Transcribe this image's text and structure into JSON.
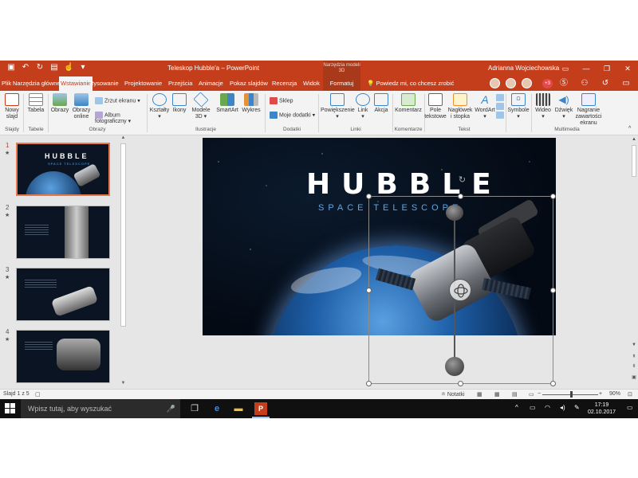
{
  "window": {
    "title": "Teleskop Hubble'a – PowerPoint",
    "context_header": "Narzędzia modeli 3D",
    "user_name": "Adrianna Wojciechowska",
    "collab_badge": "+3"
  },
  "tabs": [
    {
      "label": "Plik"
    },
    {
      "label": "Narzędzia główne"
    },
    {
      "label": "Wstawianie"
    },
    {
      "label": "Rysowanie"
    },
    {
      "label": "Projektowanie"
    },
    {
      "label": "Przejścia"
    },
    {
      "label": "Animacje"
    },
    {
      "label": "Pokaz slajdów"
    },
    {
      "label": "Recenzja"
    },
    {
      "label": "Widok"
    },
    {
      "label": "Formatuj"
    }
  ],
  "active_tab": "Wstawianie",
  "tell_me": "Powiedz mi, co chcesz zrobić",
  "ribbon": {
    "new_slide": "Nowy slajd",
    "table": "Tabela",
    "images": "Obrazy",
    "online_images": "Obrazy online",
    "screenshot": "Zrzut ekranu",
    "photo_album": "Album fotograficzny",
    "shapes": "Kształty",
    "icons": "Ikony",
    "models_3d": "Modele 3D",
    "smartart": "SmartArt",
    "chart": "Wykres",
    "store": "Sklep",
    "my_addins": "Moje dodatki",
    "zoom": "Powiększenie",
    "link": "Link",
    "action": "Akcja",
    "comment": "Komentarz",
    "textbox": "Pole tekstowe",
    "header_footer": "Nagłówek i stopka",
    "wordart": "WordArt",
    "symbols": "Symbole",
    "video": "Wideo",
    "audio": "Dźwięk",
    "screen_recording": "Nagranie zawartości ekranu",
    "groups": {
      "slides": "Slajdy",
      "tables": "Tabele",
      "images": "Obrazy",
      "illustrations": "Ilustracje",
      "addins": "Dodatki",
      "links": "Linki",
      "comments": "Komentarze",
      "text": "Tekst",
      "multimedia": "Multimedia"
    }
  },
  "slides": [
    {
      "number": "1",
      "mark": "★",
      "title": "HUBBLE",
      "subtitle": "SPACE TELESCOPE"
    },
    {
      "number": "2",
      "mark": "★",
      "title": "",
      "subtitle": ""
    },
    {
      "number": "3",
      "mark": "★",
      "title": "",
      "subtitle": ""
    },
    {
      "number": "4",
      "mark": "★",
      "title": "",
      "subtitle": ""
    }
  ],
  "current_slide": {
    "title": "HUBBLE",
    "subtitle": "SPACE TELESCOPE"
  },
  "status": {
    "slide_counter": "Slajd 1 z 5",
    "notes": "Notatki",
    "zoom": "90%",
    "zoom_minus": "−",
    "zoom_plus": "+"
  },
  "taskbar": {
    "search_placeholder": "Wpisz tutaj, aby wyszukać",
    "time": "17:19",
    "date": "02.10.2017"
  },
  "colors": {
    "accent": "#c43e1c",
    "context": "#a8391b",
    "selected_border": "#e8794f",
    "subtitle_blue": "#5da6e8"
  }
}
